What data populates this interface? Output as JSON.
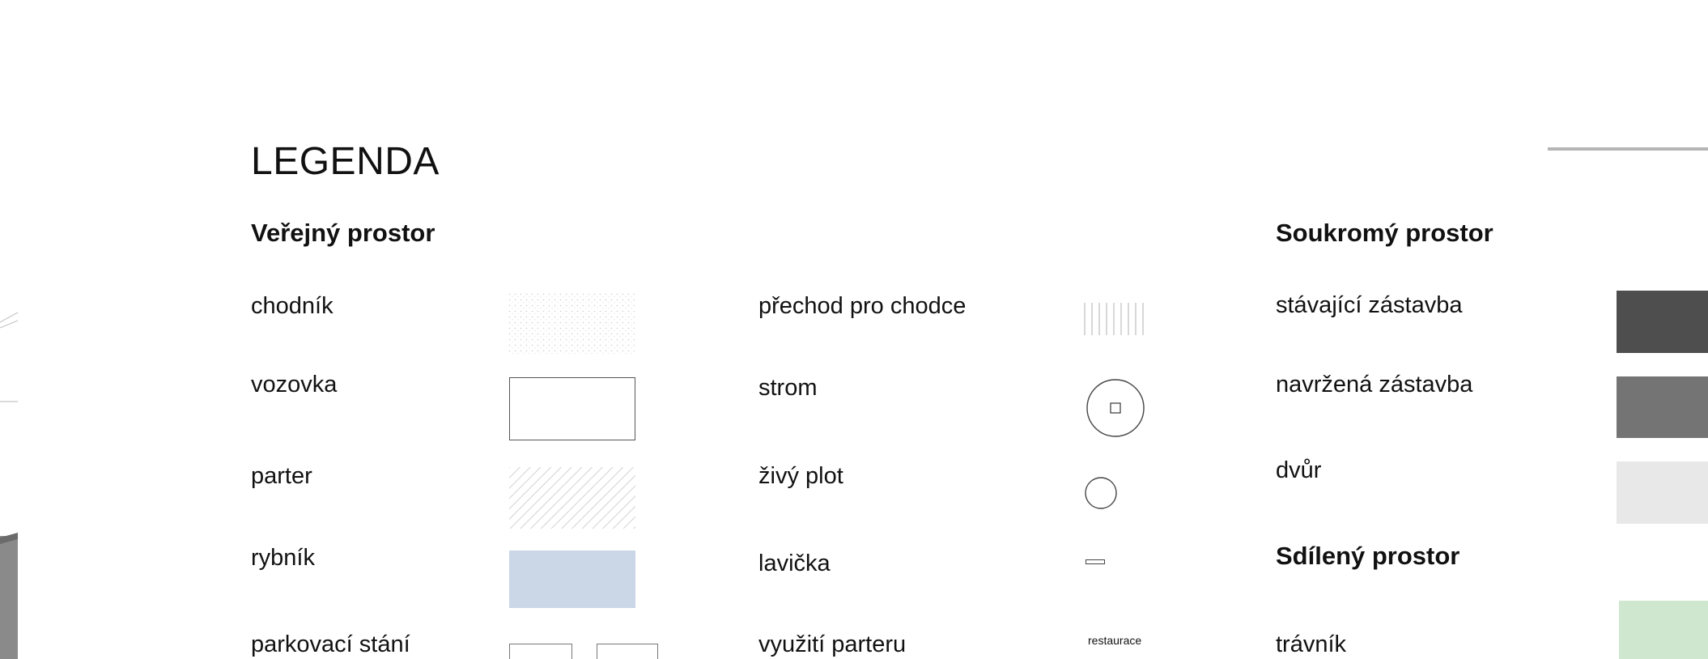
{
  "title": "LEGENDA",
  "headings": {
    "public": "Veřejný prostor",
    "private": "Soukromý prostor",
    "shared": "Sdílený prostor"
  },
  "public_col1": {
    "chodnik": "chodník",
    "vozovka": "vozovka",
    "parter": "parter",
    "rybnik": "rybník",
    "parkovani": "parkovací stání"
  },
  "public_col2": {
    "prechod": "přechod pro chodce",
    "strom": "strom",
    "plot": "živý plot",
    "lavicka": "lavička",
    "vyuziti": "využití parteru",
    "vyuziti_sample": "restaurace"
  },
  "private": {
    "stavajici": "stávající zástavba",
    "navrzena": "navržená zástavba",
    "dvur": "dvůr"
  },
  "shared": {
    "travnik": "trávník"
  },
  "colors": {
    "rybnik": "#cbd6e6",
    "stavajici": "#4e4e4e",
    "navrzena": "#747474",
    "dvur": "#e8e8e8",
    "travnik": "#cfe6cf"
  }
}
